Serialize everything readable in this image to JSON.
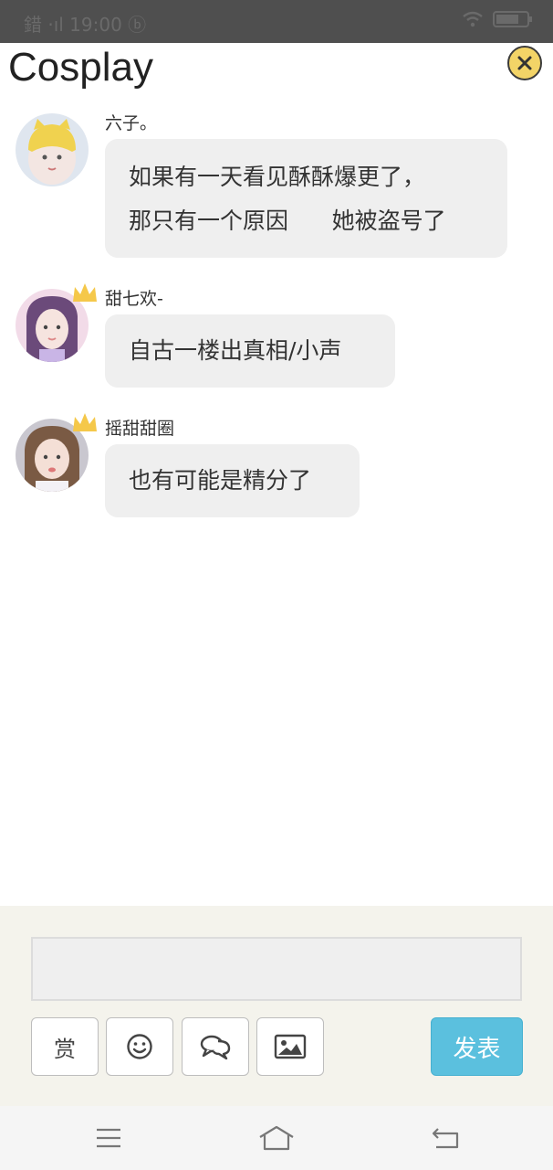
{
  "status_bar": {
    "left_text": "錯 ·ıl 19:00 ⓑ"
  },
  "header": {
    "title": "Cosplay"
  },
  "messages": [
    {
      "username": "六子。",
      "lines": [
        "如果有一天看见酥酥爆更了，",
        "那只有一个原因      她被盗号了"
      ],
      "has_crown": false
    },
    {
      "username": "甜七欢-",
      "lines": [
        "自古一楼出真相/小声"
      ],
      "has_crown": true
    },
    {
      "username": "摇甜甜圈",
      "lines": [
        "也有可能是精分了"
      ],
      "has_crown": true
    }
  ],
  "composer": {
    "input_value": "",
    "reward_label": "赏",
    "send_label": "发表",
    "tools": [
      "reward-icon",
      "emoji-icon",
      "comment-icon",
      "image-icon"
    ]
  },
  "nav": {
    "buttons": [
      "menu-icon",
      "home-icon",
      "back-icon"
    ]
  },
  "colors": {
    "send_button": "#5bc0de",
    "close_button": "#f3d467",
    "bubble": "#efefef",
    "composer_bg": "#f4f3ec"
  }
}
